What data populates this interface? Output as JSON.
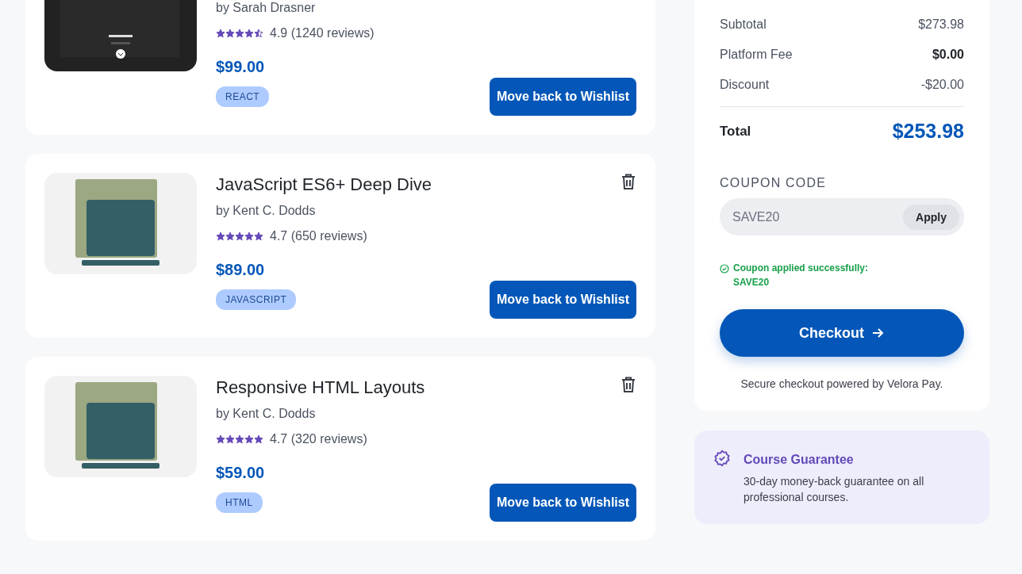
{
  "courses": [
    {
      "author": "by Sarah Drasner",
      "stars": 4.5,
      "rating": "4.9 (1240 reviews)",
      "price": "$99.00",
      "tag": "REACT",
      "kind": "picture",
      "button": "Move back to Wishlist"
    },
    {
      "title": "JavaScript ES6+ Deep Dive",
      "author": "by Kent C. Dodds",
      "stars": 5,
      "rating": "4.7 (650 reviews)",
      "price": "$89.00",
      "tag": "JAVASCRIPT",
      "kind": "picture",
      "button": "Move back to Wishlist"
    },
    {
      "title": "Responsive HTML Layouts",
      "author": "by Kent C. Dodds",
      "stars": 5,
      "rating": "4.7 (320 reviews)",
      "price": "$59.00",
      "tag": "HTML",
      "kind": "picture",
      "button": "Move back to Wishlist"
    }
  ],
  "summary": {
    "rows": [
      {
        "label": "Subtotal",
        "value": "$273.98",
        "bold": false
      },
      {
        "label": "Platform Fee",
        "value": "$0.00",
        "bold": true
      },
      {
        "label": "Discount",
        "value": "-$20.00",
        "bold": false
      }
    ],
    "total_label": "Total",
    "total_value": "$253.98",
    "coupon_label": "COUPON CODE",
    "coupon_value": "SAVE20",
    "apply_button": "Apply",
    "coupon_message": "Coupon applied successfully: SAVE20",
    "checkout_button": "Checkout",
    "secure_note": "Secure checkout powered by Velora Pay."
  },
  "guarantee": {
    "title": "Course Guarantee",
    "text": "30-day money-back guarantee on all professional courses."
  }
}
